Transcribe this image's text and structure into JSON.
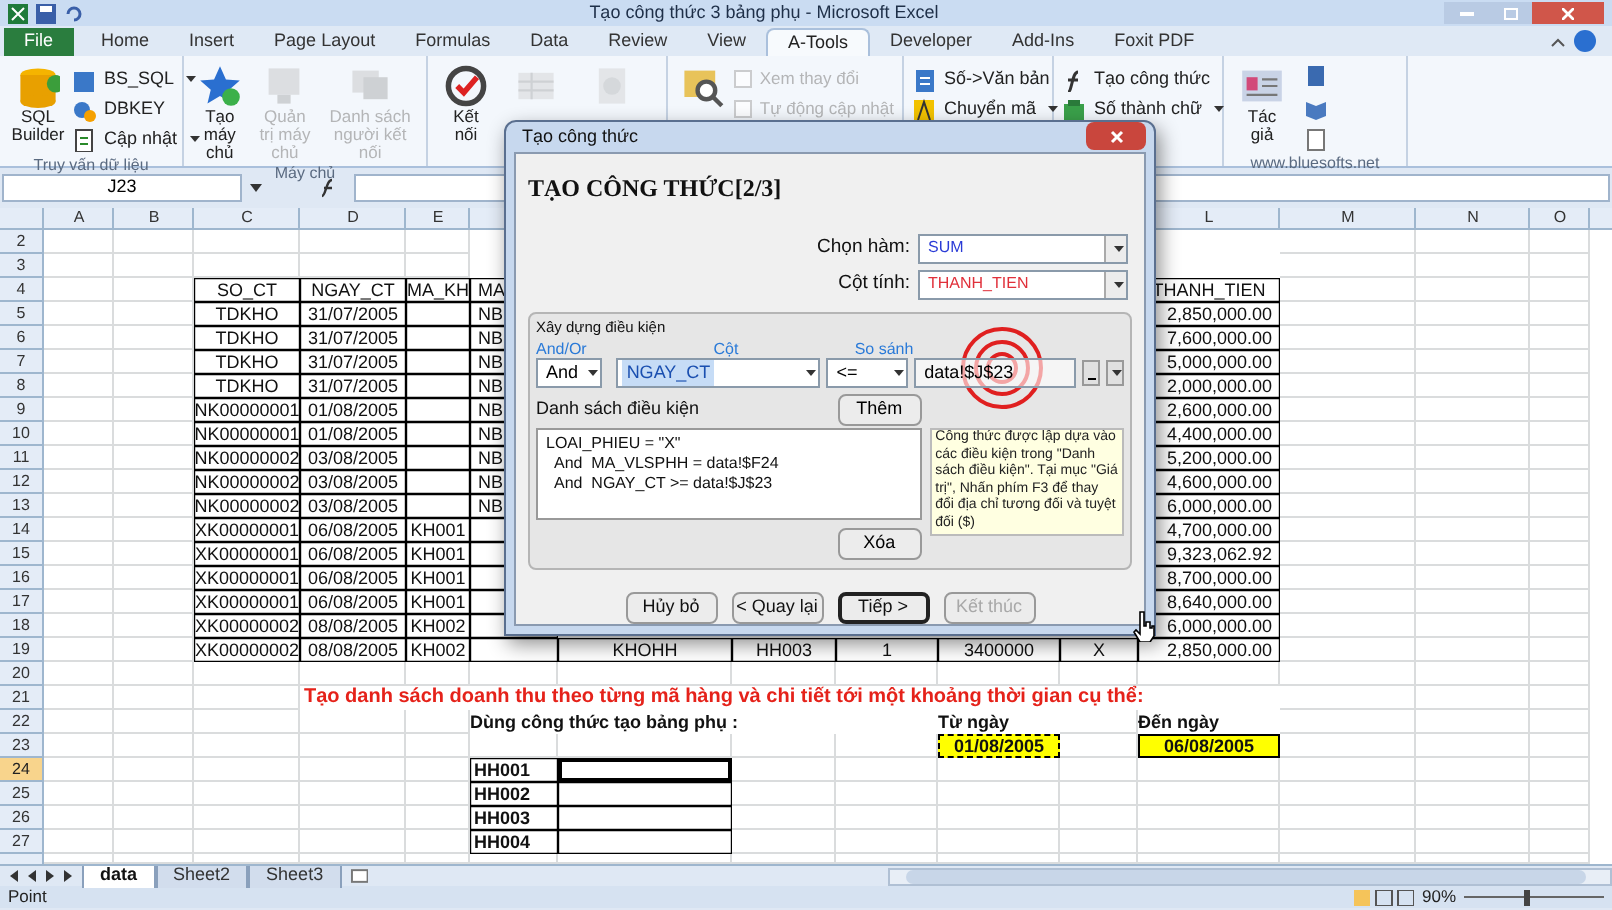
{
  "window": {
    "title": "Tạo công thức 3 bảng phụ  -  Microsoft Excel"
  },
  "ribbon": {
    "tabs": [
      {
        "label": "File",
        "selected": false
      },
      {
        "label": "Home",
        "selected": false
      },
      {
        "label": "Insert",
        "selected": false
      },
      {
        "label": "Page Layout",
        "selected": false
      },
      {
        "label": "Formulas",
        "selected": false
      },
      {
        "label": "Data",
        "selected": false
      },
      {
        "label": "Review",
        "selected": false
      },
      {
        "label": "View",
        "selected": false
      },
      {
        "label": "A-Tools",
        "selected": true
      },
      {
        "label": "Developer",
        "selected": false
      },
      {
        "label": "Add-Ins",
        "selected": false
      },
      {
        "label": "Foxit PDF",
        "selected": false
      }
    ],
    "groups": [
      {
        "label": "Truy vấn dữ liệu",
        "items": [
          {
            "kind": "large",
            "label": "SQL Builder",
            "disabled": false
          },
          {
            "kind": "small",
            "label": "BS_SQL",
            "menu": true,
            "disabled": false
          },
          {
            "kind": "small",
            "label": "DBKEY",
            "menu": false,
            "disabled": false
          },
          {
            "kind": "small",
            "label": "Cập nhật",
            "menu": true,
            "disabled": false
          }
        ]
      },
      {
        "label": "Máy chủ",
        "items": [
          {
            "kind": "large",
            "label": "Tạo máy chủ",
            "disabled": false
          },
          {
            "kind": "large",
            "label": "Quản trị máy chủ",
            "disabled": true
          },
          {
            "kind": "large",
            "label": "Danh sách người kết nối",
            "disabled": true
          }
        ]
      },
      {
        "items": [
          {
            "kind": "large",
            "label": "Kết nối",
            "disabled": false
          },
          {
            "kind": "large",
            "disabled": true
          },
          {
            "kind": "large",
            "disabled": true
          }
        ]
      },
      {
        "items": [
          {
            "kind": "large",
            "disabled": false
          },
          {
            "kind": "check",
            "label": "Xem thay đổi",
            "checked": false,
            "disabled": true
          },
          {
            "kind": "check",
            "label": "Tự động cập nhật",
            "checked": false,
            "disabled": true
          }
        ]
      },
      {
        "items": [
          {
            "kind": "small",
            "label": "Số->Văn bản",
            "menu": false,
            "disabled": false
          },
          {
            "kind": "small",
            "label": "Chuyển mã",
            "menu": true,
            "disabled": false
          }
        ]
      },
      {
        "items": [
          {
            "kind": "small",
            "label": "Tạo công thức",
            "menu": false,
            "disabled": false
          },
          {
            "kind": "small",
            "label": "Số thành chữ",
            "menu": true,
            "disabled": false
          }
        ]
      },
      {
        "label": "www.bluesofts.net",
        "items": [
          {
            "kind": "large",
            "label": "Tác giả",
            "disabled": false
          },
          {
            "kind": "icons",
            "disabled": false
          }
        ]
      }
    ]
  },
  "sheet": {
    "name_box": "J23",
    "columns": [
      "A",
      "B",
      "C",
      "D",
      "E",
      "L",
      "M",
      "N",
      "O"
    ],
    "rows": [
      {
        "number": "2",
        "selected": false
      },
      {
        "number": "3",
        "selected": false
      },
      {
        "number": "4",
        "selected": false,
        "cells": [
          {
            "text": "SO_CT",
            "kind": "table"
          },
          {
            "text": "NGAY_CT",
            "kind": "table"
          },
          {
            "text": "MA_KH",
            "kind": "table"
          },
          {
            "text": "MA",
            "kind": "table_left"
          },
          {
            "text": "THANH_TIEN",
            "kind": "table"
          }
        ]
      },
      {
        "number": "5",
        "selected": false,
        "cells": [
          {
            "text": "TDKHO",
            "kind": "table"
          },
          {
            "text": "31/07/2005",
            "kind": "table"
          },
          {
            "kind": "table"
          },
          {
            "text": "NB",
            "kind": "table_left"
          },
          {
            "text": "2,850,000.00",
            "kind": "table_right"
          }
        ]
      },
      {
        "number": "6",
        "selected": false,
        "cells": [
          {
            "text": "TDKHO",
            "kind": "table"
          },
          {
            "text": "31/07/2005",
            "kind": "table"
          },
          {
            "kind": "table"
          },
          {
            "text": "NB",
            "kind": "table_left"
          },
          {
            "text": "7,600,000.00",
            "kind": "table_right"
          }
        ]
      },
      {
        "number": "7",
        "selected": false,
        "cells": [
          {
            "text": "TDKHO",
            "kind": "table"
          },
          {
            "text": "31/07/2005",
            "kind": "table"
          },
          {
            "kind": "table"
          },
          {
            "text": "NB",
            "kind": "table_left"
          },
          {
            "text": "5,000,000.00",
            "kind": "table_right"
          }
        ]
      },
      {
        "number": "8",
        "selected": false,
        "cells": [
          {
            "text": "TDKHO",
            "kind": "table"
          },
          {
            "text": "31/07/2005",
            "kind": "table"
          },
          {
            "kind": "table"
          },
          {
            "text": "NB",
            "kind": "table_left"
          },
          {
            "text": "2,000,000.00",
            "kind": "table_right"
          }
        ]
      },
      {
        "number": "9",
        "selected": false,
        "cells": [
          {
            "text": "NK00000001",
            "kind": "table"
          },
          {
            "text": "01/08/2005",
            "kind": "table"
          },
          {
            "kind": "table"
          },
          {
            "text": "NB",
            "kind": "table_left"
          },
          {
            "text": "2,600,000.00",
            "kind": "table_right"
          }
        ]
      },
      {
        "number": "10",
        "selected": false,
        "cells": [
          {
            "text": "NK00000001",
            "kind": "table"
          },
          {
            "text": "01/08/2005",
            "kind": "table"
          },
          {
            "kind": "table"
          },
          {
            "text": "NB",
            "kind": "table_left"
          },
          {
            "text": "4,400,000.00",
            "kind": "table_right"
          }
        ]
      },
      {
        "number": "11",
        "selected": false,
        "cells": [
          {
            "text": "NK00000002",
            "kind": "table"
          },
          {
            "text": "03/08/2005",
            "kind": "table"
          },
          {
            "kind": "table"
          },
          {
            "text": "NB",
            "kind": "table_left"
          },
          {
            "text": "5,200,000.00",
            "kind": "table_right"
          }
        ]
      },
      {
        "number": "12",
        "selected": false,
        "cells": [
          {
            "text": "NK00000002",
            "kind": "table"
          },
          {
            "text": "03/08/2005",
            "kind": "table"
          },
          {
            "kind": "table"
          },
          {
            "text": "NB",
            "kind": "table_left"
          },
          {
            "text": "4,600,000.00",
            "kind": "table_right"
          }
        ]
      },
      {
        "number": "13",
        "selected": false,
        "cells": [
          {
            "text": "NK00000002",
            "kind": "table"
          },
          {
            "text": "03/08/2005",
            "kind": "table"
          },
          {
            "kind": "table"
          },
          {
            "text": "NB",
            "kind": "table_left"
          },
          {
            "text": "6,000,000.00",
            "kind": "table_right"
          }
        ]
      },
      {
        "number": "14",
        "selected": false,
        "cells": [
          {
            "text": "XK00000001",
            "kind": "table"
          },
          {
            "text": "06/08/2005",
            "kind": "table"
          },
          {
            "text": "KH001",
            "kind": "table"
          },
          {
            "kind": "table"
          },
          {
            "text": "4,700,000.00",
            "kind": "table_right"
          }
        ]
      },
      {
        "number": "15",
        "selected": false,
        "cells": [
          {
            "text": "XK00000001",
            "kind": "table"
          },
          {
            "text": "06/08/2005",
            "kind": "table"
          },
          {
            "text": "KH001",
            "kind": "table"
          },
          {
            "kind": "table"
          },
          {
            "text": "9,323,062.92",
            "kind": "table_right"
          }
        ]
      },
      {
        "number": "16",
        "selected": false,
        "cells": [
          {
            "text": "XK00000001",
            "kind": "table"
          },
          {
            "text": "06/08/2005",
            "kind": "table"
          },
          {
            "text": "KH001",
            "kind": "table"
          },
          {
            "kind": "table"
          },
          {
            "text": "8,700,000.00",
            "kind": "table_right"
          }
        ]
      },
      {
        "number": "17",
        "selected": false,
        "cells": [
          {
            "text": "XK00000001",
            "kind": "table"
          },
          {
            "text": "06/08/2005",
            "kind": "table"
          },
          {
            "text": "KH001",
            "kind": "table"
          },
          {
            "kind": "table"
          },
          {
            "text": "8,640,000.00",
            "kind": "table_right"
          }
        ]
      },
      {
        "number": "18",
        "selected": false,
        "cells": [
          {
            "text": "XK00000002",
            "kind": "table"
          },
          {
            "text": "08/08/2005",
            "kind": "table"
          },
          {
            "text": "KH002",
            "kind": "table"
          },
          {
            "kind": "table"
          },
          {
            "text": "6,000,000.00",
            "kind": "table_right"
          }
        ]
      },
      {
        "number": "19",
        "selected": false,
        "cells": [
          {
            "text": "XK00000002",
            "kind": "table"
          },
          {
            "text": "08/08/2005",
            "kind": "table"
          },
          {
            "text": "KH002",
            "kind": "table"
          },
          {
            "kind": "table"
          },
          {
            "text": "KHOHH",
            "kind": "table"
          },
          {
            "text": "HH003",
            "kind": "table"
          },
          {
            "text": "1",
            "kind": "table"
          },
          {
            "text": "3400000",
            "kind": "table"
          },
          {
            "text": "X",
            "kind": "table"
          },
          {
            "text": "2,850,000.00",
            "kind": "table_right"
          }
        ]
      },
      {
        "number": "20",
        "selected": false
      },
      {
        "number": "21",
        "selected": false,
        "cells": [
          {
            "text": "Tạo danh sách doanh thu  theo từng mã hàng và chi tiết tới một khoảng thời gian cụ thể:",
            "kind": "heading"
          }
        ]
      },
      {
        "number": "22",
        "selected": false,
        "cells": [
          {
            "text": "Dùng công thức tạo bảng phụ :",
            "kind": "bold"
          },
          {
            "text": "Từ ngày",
            "kind": "bold"
          },
          {
            "text": "Đến ngày",
            "kind": "bold"
          }
        ]
      },
      {
        "number": "23",
        "selected": false,
        "cells": [
          {
            "text": "01/08/2005",
            "kind": "date_copy"
          },
          {
            "text": "06/08/2005",
            "kind": "date"
          }
        ]
      },
      {
        "number": "24",
        "selected": true,
        "cells": [
          {
            "text": "HH001",
            "kind": "code"
          },
          {
            "kind": "active"
          }
        ]
      },
      {
        "number": "25",
        "selected": false,
        "cells": [
          {
            "text": "HH002",
            "kind": "code"
          },
          {
            "kind": "table"
          }
        ]
      },
      {
        "number": "26",
        "selected": false,
        "cells": [
          {
            "text": "HH003",
            "kind": "code"
          },
          {
            "kind": "table"
          }
        ]
      },
      {
        "number": "27",
        "selected": false,
        "cells": [
          {
            "text": "HH004",
            "kind": "code"
          },
          {
            "kind": "table"
          }
        ]
      }
    ]
  },
  "sheet_tabs": [
    {
      "label": "data",
      "selected": true
    },
    {
      "label": "Sheet2",
      "selected": false
    },
    {
      "label": "Sheet3",
      "selected": false
    }
  ],
  "status_bar": {
    "mode": "Point",
    "zoom": "90%",
    "level": 0.45
  },
  "dialog": {
    "title": "Tạo công thức",
    "heading": "TẠO CÔNG THỨC[2/3]",
    "fields": [
      {
        "label": "Chọn hàm:",
        "value": "SUM",
        "color": "#2a3bd6"
      },
      {
        "label": "Cột tính:",
        "value": "THANH_TIEN",
        "color": "#e0303a"
      }
    ],
    "group_title": "Xây dựng điều kiện",
    "column_labels": [
      "And/Or",
      "Cột",
      "So sánh"
    ],
    "logic": "And",
    "column": "NGAY_CT",
    "operator": "<=",
    "value": "data!$J$23",
    "list_label": "Danh sách điều kiện",
    "add_button": "Thêm",
    "conditions": [
      "LOAI_PHIEU = \"X\"",
      "And  MA_VLSPHH = data!$F24",
      "And  NGAY_CT >= data!$J$23"
    ],
    "delete_button": "Xóa",
    "hint": "Công thức được lập dựa vào các điều kiện trong \"Danh sách điều kiện\". Tại mục \"Giá trị\", Nhấn phím F3 để thay đổi địa chỉ tương đối và tuyệt đối ($)",
    "buttons": [
      {
        "label": "Hủy bỏ",
        "default": false,
        "disabled": false
      },
      {
        "label": "< Quay lại",
        "default": false,
        "disabled": false
      },
      {
        "label": "Tiếp >",
        "default": true,
        "disabled": false
      },
      {
        "label": "Kết thúc",
        "default": false,
        "disabled": true
      }
    ]
  }
}
